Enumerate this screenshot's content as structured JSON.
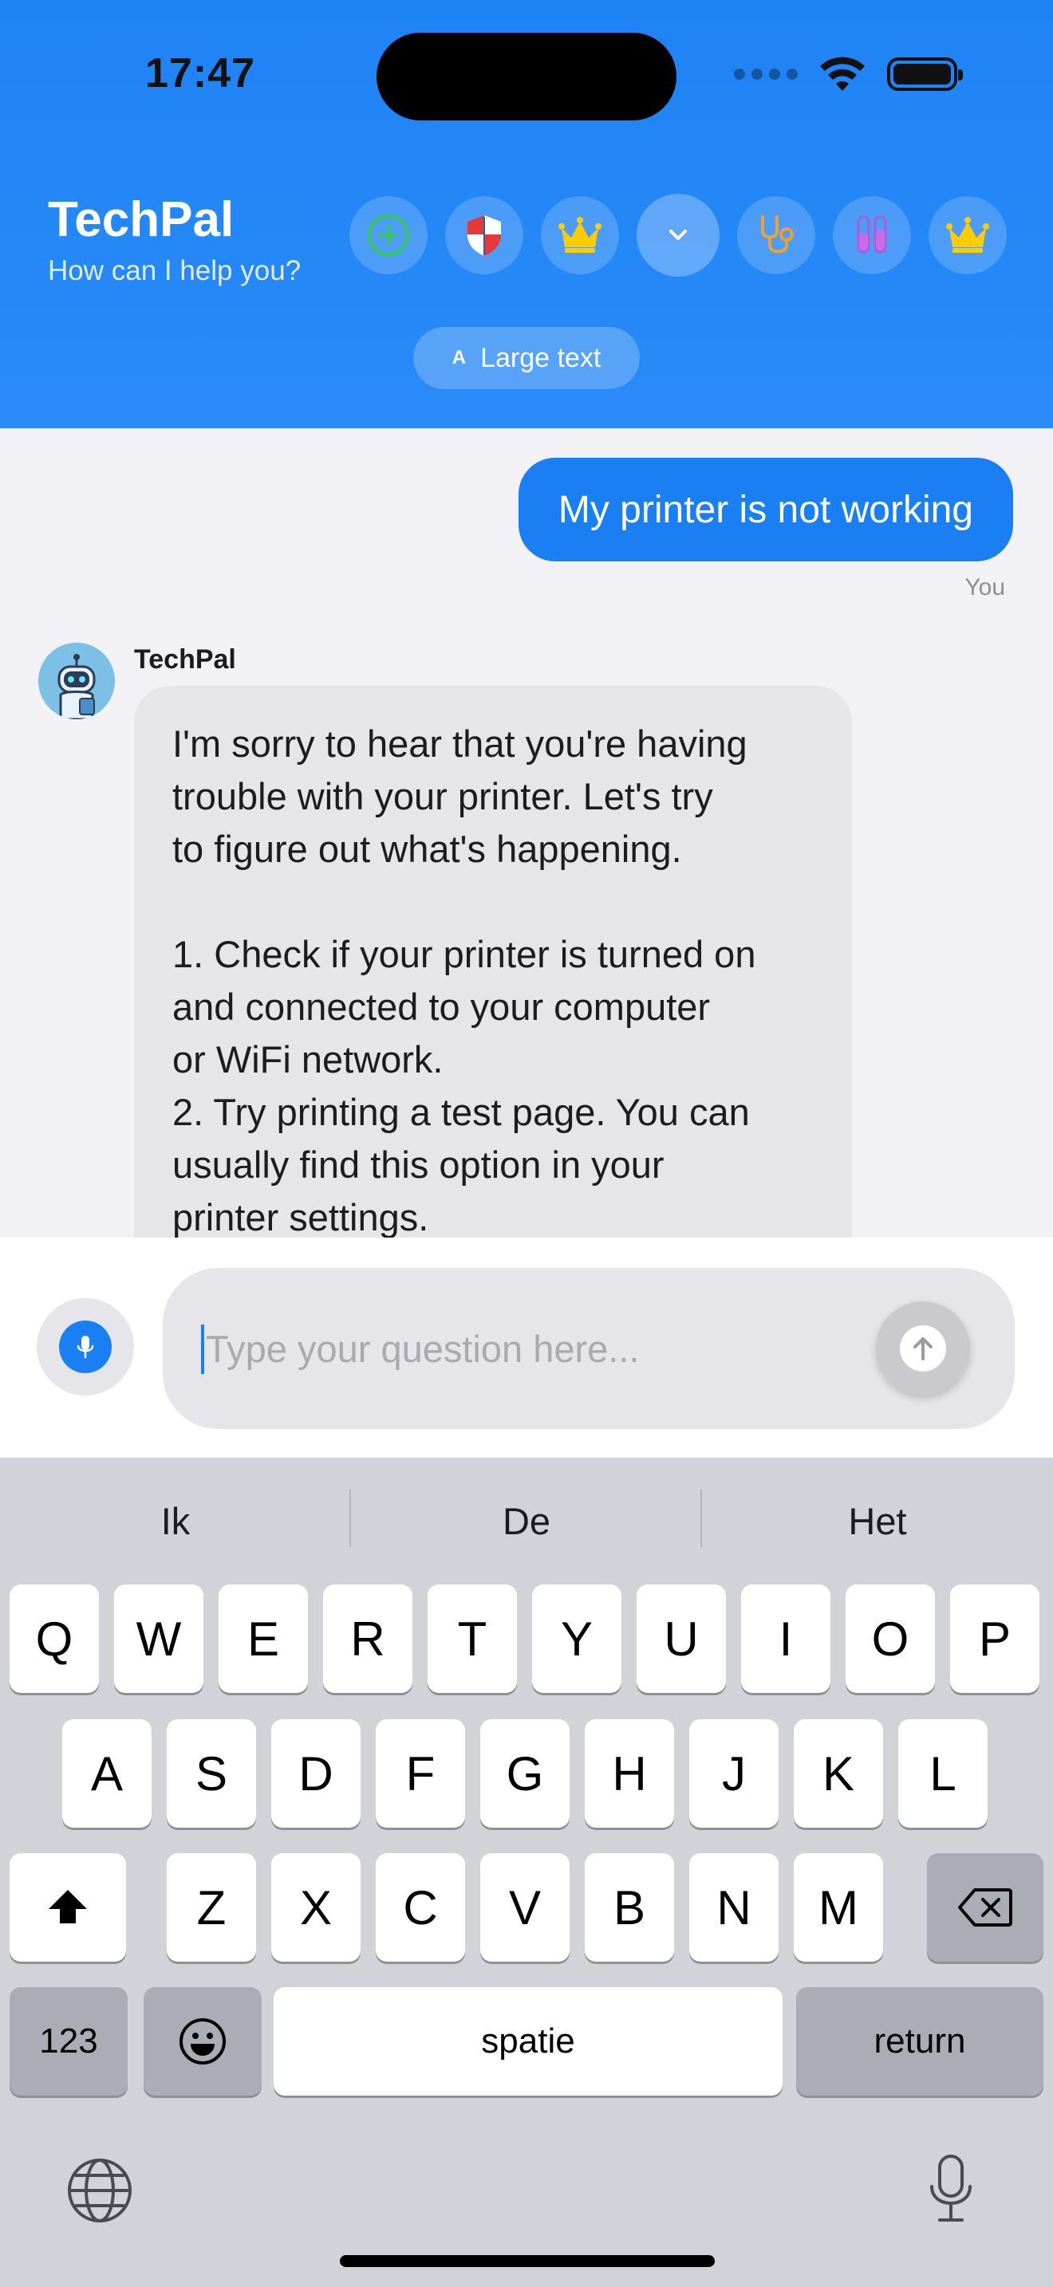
{
  "status_bar": {
    "time": "17:47"
  },
  "header": {
    "title": "TechPal",
    "subtitle": "How can I help you?",
    "icons": [
      "plus-circle-icon",
      "shield-icon",
      "crown-icon",
      "chevron-down-icon",
      "stethoscope-icon",
      "test-tubes-icon",
      "crown-icon"
    ],
    "large_text_icon": "A",
    "large_text_label": "Large text",
    "brand_color": "#1e83f5"
  },
  "chat": {
    "user_message": "My printer is not working",
    "user_tag": "You",
    "bot_name": "TechPal",
    "bot_message": "I'm sorry to hear that you're having\ntrouble with your printer. Let's try\nto figure out what's happening.\n\n1. Check if your printer is turned on\nand connected to your computer\nor WiFi network.\n2. Try printing a test page. You can\nusually find this option in your\nprinter settings."
  },
  "input": {
    "placeholder": "Type your question here..."
  },
  "keyboard": {
    "suggestions": [
      "Ik",
      "De",
      "Het"
    ],
    "row1": [
      "Q",
      "W",
      "E",
      "R",
      "T",
      "Y",
      "U",
      "I",
      "O",
      "P"
    ],
    "row2": [
      "A",
      "S",
      "D",
      "F",
      "G",
      "H",
      "J",
      "K",
      "L"
    ],
    "row3": [
      "Z",
      "X",
      "C",
      "V",
      "B",
      "N",
      "M"
    ],
    "numbers_label": "123",
    "space_label": "spatie",
    "return_label": "return"
  }
}
